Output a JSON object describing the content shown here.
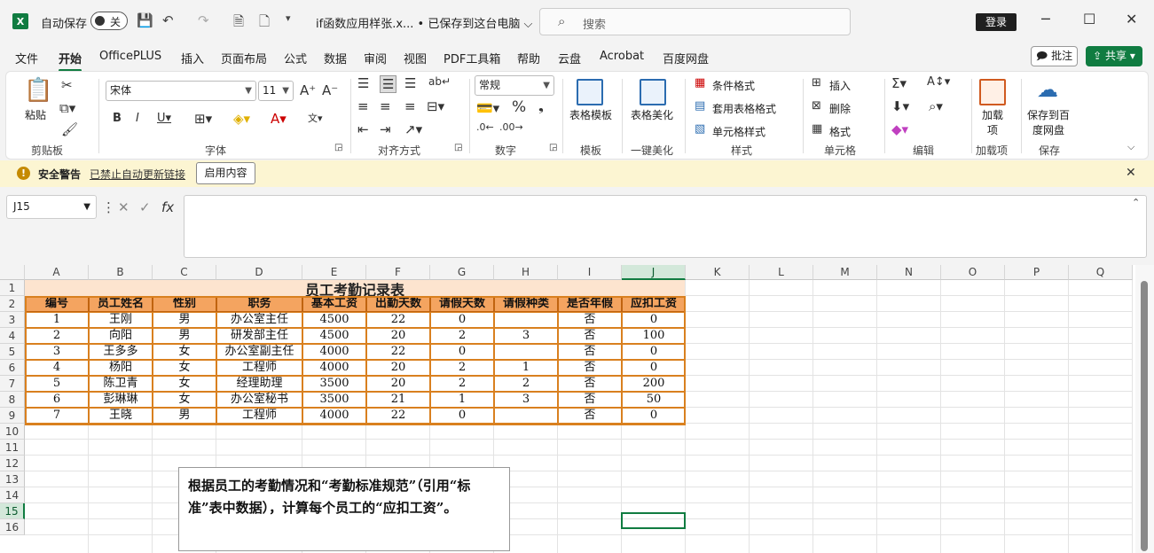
{
  "titlebar": {
    "autosave_label": "自动保存",
    "autosave_state": "关",
    "doc_title": "if函数应用样张.x... • 已保存到这台电脑 ⌵",
    "search_placeholder": "搜索",
    "login": "登录"
  },
  "menu": {
    "items": [
      "文件",
      "开始",
      "OfficePLUS",
      "插入",
      "页面布局",
      "公式",
      "数据",
      "审阅",
      "视图",
      "PDF工具箱",
      "帮助",
      "云盘",
      "Acrobat",
      "百度网盘"
    ],
    "active": "开始",
    "comment_btn": "批注",
    "share_btn": "共享"
  },
  "ribbon": {
    "paste": "粘贴",
    "clipboard": "剪贴板",
    "font_name": "宋体",
    "font_size": "11",
    "font_group": "字体",
    "align_group": "对齐方式",
    "number_format": "常规",
    "number_group": "数字",
    "table_template": "表格模板",
    "template_group": "模板",
    "table_beautify": "表格美化",
    "beautify_group": "一键美化",
    "cond_format": "条件格式",
    "table_format": "套用表格格式",
    "cell_style": "单元格样式",
    "style_group": "样式",
    "insert": "插入",
    "delete": "删除",
    "format": "格式",
    "cells_group": "单元格",
    "edit_group": "编辑",
    "addin": "加载项",
    "addin_group": "加载项",
    "save_baidu": "保存到百度网盘",
    "save_group": "保存"
  },
  "warning": {
    "title": "安全警告",
    "link": "已禁止自动更新链接",
    "button": "启用内容"
  },
  "formula_bar": {
    "name_box": "J15",
    "fx": "fx",
    "formula": ""
  },
  "sheet": {
    "columns": [
      "A",
      "B",
      "C",
      "D",
      "E",
      "F",
      "G",
      "H",
      "I",
      "J",
      "K",
      "L",
      "M",
      "N",
      "O",
      "P",
      "Q"
    ],
    "rows": [
      "1",
      "2",
      "3",
      "4",
      "5",
      "6",
      "7",
      "8",
      "9",
      "10",
      "11",
      "12",
      "13",
      "14",
      "15",
      "16"
    ],
    "title": "员工考勤记录表",
    "headers": [
      "编号",
      "员工姓名",
      "性别",
      "职务",
      "基本工资",
      "出勤天数",
      "请假天数",
      "请假种类",
      "是否年假",
      "应扣工资"
    ],
    "data": [
      [
        "1",
        "王刚",
        "男",
        "办公室主任",
        "4500",
        "22",
        "0",
        "",
        "否",
        "0"
      ],
      [
        "2",
        "向阳",
        "男",
        "研发部主任",
        "4500",
        "20",
        "2",
        "3",
        "否",
        "100"
      ],
      [
        "3",
        "王多多",
        "女",
        "办公室副主任",
        "4000",
        "22",
        "0",
        "",
        "否",
        "0"
      ],
      [
        "4",
        "杨阳",
        "女",
        "工程师",
        "4000",
        "20",
        "2",
        "1",
        "否",
        "0"
      ],
      [
        "5",
        "陈卫青",
        "女",
        "经理助理",
        "3500",
        "20",
        "2",
        "2",
        "否",
        "200"
      ],
      [
        "6",
        "彭琳琳",
        "女",
        "办公室秘书",
        "3500",
        "21",
        "1",
        "3",
        "否",
        "50"
      ],
      [
        "7",
        "王晓",
        "男",
        "工程师",
        "4000",
        "22",
        "0",
        "",
        "否",
        "0"
      ]
    ],
    "note": "根据员工的考勤情况和“考勤标准规范”（引用“标准”表中数据），计算每个员工的“应扣工资”。"
  }
}
